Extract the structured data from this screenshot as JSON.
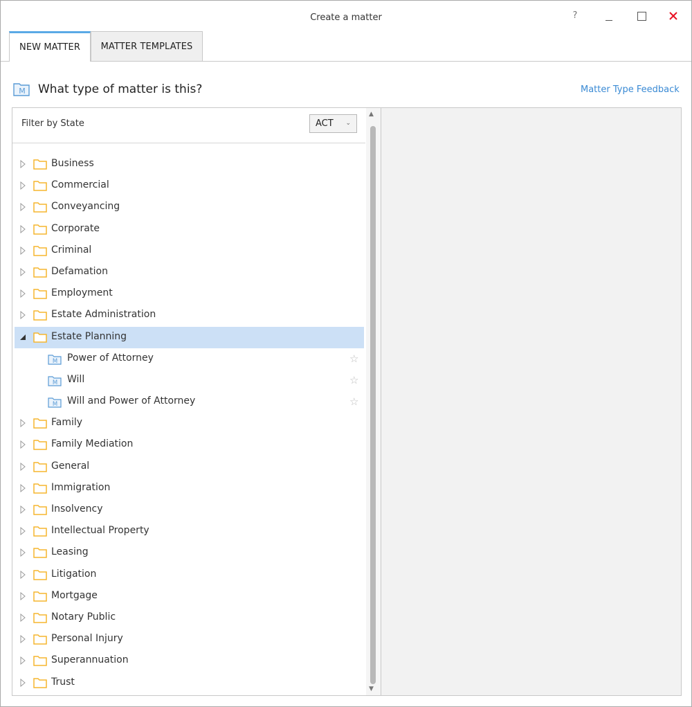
{
  "window": {
    "title": "Create a matter",
    "help_label": "?"
  },
  "tabs": [
    {
      "label": "NEW MATTER",
      "active": true
    },
    {
      "label": "MATTER TEMPLATES",
      "active": false
    }
  ],
  "header": {
    "question": "What type of matter is this?",
    "feedback_link": "Matter Type Feedback"
  },
  "filter": {
    "label": "Filter by State",
    "selected_state": "ACT"
  },
  "tree": [
    {
      "label": "Business"
    },
    {
      "label": "Commercial"
    },
    {
      "label": "Conveyancing"
    },
    {
      "label": "Corporate"
    },
    {
      "label": "Criminal"
    },
    {
      "label": "Defamation"
    },
    {
      "label": "Employment"
    },
    {
      "label": "Estate Administration"
    },
    {
      "label": "Estate Planning",
      "expanded": true,
      "selected": true,
      "children": [
        "Power of Attorney",
        "Will",
        "Will and Power of Attorney"
      ]
    },
    {
      "label": "Family"
    },
    {
      "label": "Family Mediation"
    },
    {
      "label": "General"
    },
    {
      "label": "Immigration"
    },
    {
      "label": "Insolvency"
    },
    {
      "label": "Intellectual Property"
    },
    {
      "label": "Leasing"
    },
    {
      "label": "Litigation"
    },
    {
      "label": "Mortgage"
    },
    {
      "label": "Notary Public"
    },
    {
      "label": "Personal Injury"
    },
    {
      "label": "Superannuation"
    },
    {
      "label": "Trust"
    }
  ],
  "colors": {
    "accent": "#5aa9e6",
    "link": "#3a8ad4",
    "selection": "#cce0f6",
    "folder": "#f5b52e",
    "close": "#e81123"
  },
  "icons": {
    "folder": "folder-icon",
    "matter": "matter-m-icon",
    "star": "star-outline-icon",
    "expand": "triangle-right-icon",
    "collapse": "triangle-down-icon"
  }
}
